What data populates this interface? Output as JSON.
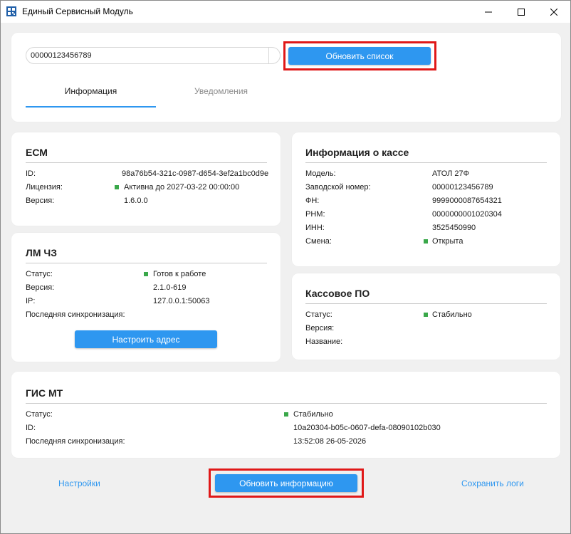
{
  "window": {
    "title": "Единый Сервисный Модуль",
    "icon": "app-grid-icon",
    "controls": [
      "minimize-icon",
      "maximize-icon",
      "close-icon"
    ]
  },
  "top": {
    "search_value": "00000123456789",
    "refresh_list_label": "Обновить список",
    "tabs": [
      {
        "label": "Информация",
        "active": true
      },
      {
        "label": "Уведомления",
        "active": false
      }
    ]
  },
  "ecm": {
    "title": "ЕСМ",
    "rows": [
      {
        "label": "ID:",
        "value": "98a76b54-321c-0987-d654-3ef2a1bc0d9e"
      },
      {
        "label": "Лицензия:",
        "value": "Активна до 2027-03-22 00:00:00",
        "status": "green"
      },
      {
        "label": "Версия:",
        "value": "1.6.0.0"
      }
    ]
  },
  "kassa": {
    "title": "Информация о кассе",
    "rows": [
      {
        "label": "Модель:",
        "value": "АТОЛ 27Ф"
      },
      {
        "label": "Заводской номер:",
        "value": "00000123456789"
      },
      {
        "label": "ФН:",
        "value": "9999000087654321"
      },
      {
        "label": "РНМ:",
        "value": "0000000001020304"
      },
      {
        "label": "ИНН:",
        "value": "3525450990"
      },
      {
        "label": "Смена:",
        "value": "Открыта",
        "status": "green"
      }
    ]
  },
  "lm": {
    "title": "ЛМ ЧЗ",
    "rows": [
      {
        "label": "Статус:",
        "value": "Готов к работе",
        "status": "green"
      },
      {
        "label": "Версия:",
        "value": "2.1.0-619"
      },
      {
        "label": "IP:",
        "value": "127.0.0.1:50063"
      },
      {
        "label": "Последняя синхронизация:",
        "value": ""
      }
    ],
    "button_label": "Настроить адрес"
  },
  "po": {
    "title": "Кассовое ПО",
    "rows": [
      {
        "label": "Статус:",
        "value": "Стабильно",
        "status": "green"
      },
      {
        "label": "Версия:",
        "value": ""
      },
      {
        "label": "Название:",
        "value": ""
      }
    ]
  },
  "gis": {
    "title": "ГИС МТ",
    "rows": [
      {
        "label": "Статус:",
        "value": "Стабильно",
        "status": "green"
      },
      {
        "label": "ID:",
        "value": "10a20304-b05c-0607-defa-08090102b030"
      },
      {
        "label": "Последняя синхронизация:",
        "value": "13:52:08 26-05-2026"
      }
    ]
  },
  "footer": {
    "settings_label": "Настройки",
    "refresh_info_label": "Обновить информацию",
    "save_logs_label": "Сохранить логи"
  },
  "colors": {
    "accent": "#2e97f0",
    "status_ok": "#3aa84a",
    "highlight": "#e01818"
  }
}
